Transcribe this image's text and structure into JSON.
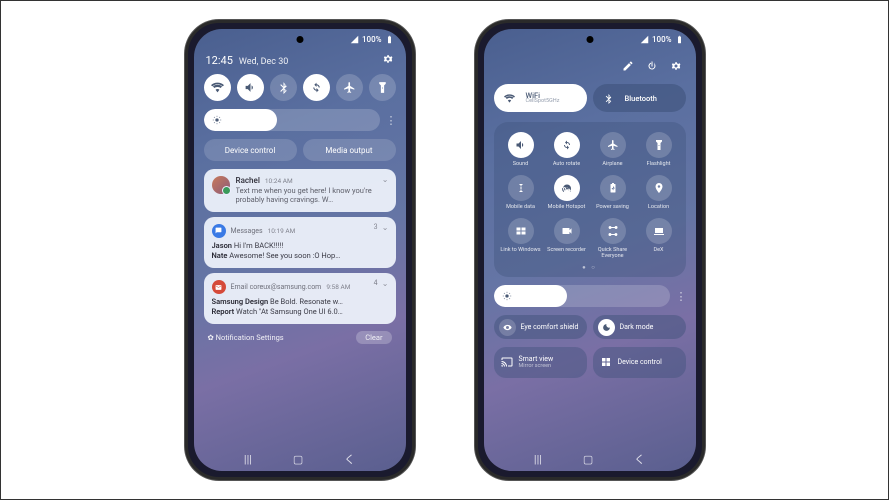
{
  "status": {
    "signal": "100%",
    "battery_icon": "full"
  },
  "phone1": {
    "clock": "12:45",
    "date": "Wed, Dec 30",
    "quick_toggles": [
      {
        "name": "wifi",
        "on": true
      },
      {
        "name": "sound",
        "on": true
      },
      {
        "name": "bluetooth",
        "on": false
      },
      {
        "name": "auto-rotate",
        "on": true
      },
      {
        "name": "airplane",
        "on": false
      },
      {
        "name": "flashlight",
        "on": false
      }
    ],
    "brightness_pct": 42,
    "device_control": "Device control",
    "media_output": "Media output",
    "notifs": [
      {
        "type": "conversation",
        "sender": "Rachel",
        "time": "10:24 AM",
        "message": "Text me when you get here! I know you're probably having cravings. W…"
      },
      {
        "type": "app",
        "app": "Messages",
        "icon": "msg",
        "time": "10:19 AM",
        "count": "3",
        "lines": [
          {
            "bold": "Jason",
            "text": "  Hi I'm BACK!!!!!"
          },
          {
            "bold": "Nate",
            "text": "  Awesome! See you soon :O Hop…"
          }
        ]
      },
      {
        "type": "app",
        "app": "Email",
        "subhead": "coreux@samsung.com",
        "icon": "email",
        "time": "9:58 AM",
        "count": "4",
        "lines": [
          {
            "bold": "Samsung Design",
            "text": "  Be Bold. Resonate w…"
          },
          {
            "bold": "Report",
            "text": "  Watch \"At Samsung One UI 6.0…"
          }
        ]
      }
    ],
    "settings_label": "Notification Settings",
    "clear_label": "Clear"
  },
  "phone2": {
    "wifi": {
      "label": "WiFi",
      "sub": "CellSpot5GHz",
      "on": true
    },
    "bluetooth": {
      "label": "Bluetooth",
      "on": false
    },
    "tiles": [
      {
        "name": "sound",
        "label": "Sound",
        "on": true
      },
      {
        "name": "auto-rotate",
        "label": "Auto rotate",
        "on": true
      },
      {
        "name": "airplane",
        "label": "Airplane",
        "on": false
      },
      {
        "name": "flashlight",
        "label": "Flashlight",
        "on": false
      },
      {
        "name": "mobile-data",
        "label": "Mobile data",
        "on": false
      },
      {
        "name": "mobile-hotspot",
        "label": "Mobile Hotspot",
        "on": true
      },
      {
        "name": "power-saving",
        "label": "Power saving",
        "on": false
      },
      {
        "name": "location",
        "label": "Location",
        "on": false
      },
      {
        "name": "link-windows",
        "label": "Link to Windows",
        "on": false
      },
      {
        "name": "screen-recorder",
        "label": "Screen recorder",
        "on": false
      },
      {
        "name": "quick-share",
        "label": "Quick Share Everyone",
        "on": false
      },
      {
        "name": "dex",
        "label": "DeX",
        "on": false
      }
    ],
    "brightness_pct": 42,
    "eye_shield": "Eye comfort shield",
    "dark_mode": "Dark mode",
    "smart_view": {
      "title": "Smart view",
      "sub": "Mirror screen"
    },
    "device_control": "Device control"
  }
}
